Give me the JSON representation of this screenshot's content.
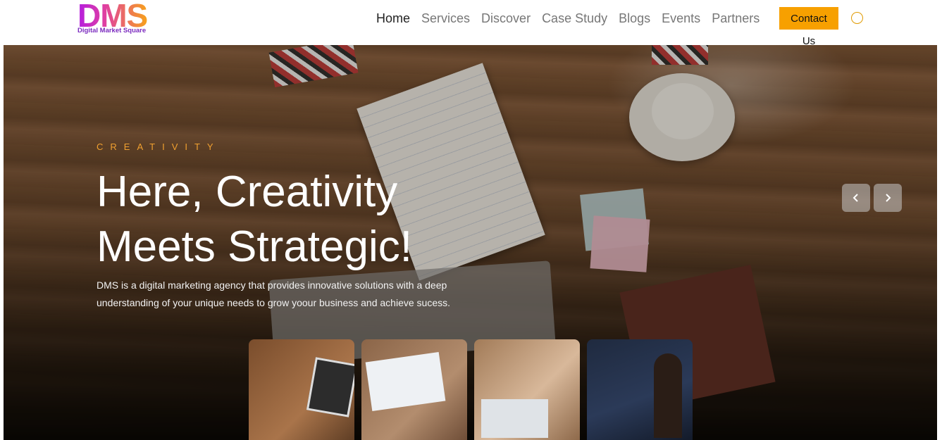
{
  "brand": {
    "logo_text": "DMS",
    "logo_subtitle": "Digital Market Square"
  },
  "nav": {
    "items": [
      "Home",
      "Services",
      "Discover",
      "Case Study",
      "Blogs",
      "Events",
      "Partners"
    ],
    "active": "Home"
  },
  "header": {
    "contact_label": "Contact Us",
    "accent_color": "#f7a000"
  },
  "hero": {
    "eyebrow": "CREATIVITY",
    "headline": "Here, Creativity Meets Strategic!",
    "description": "DMS is a digital marketing agency that provides innovative solutions with a deep understanding of your unique needs to grow yoour business and achieve sucess.",
    "prev_icon": "chevron-left-icon",
    "next_icon": "chevron-right-icon"
  }
}
